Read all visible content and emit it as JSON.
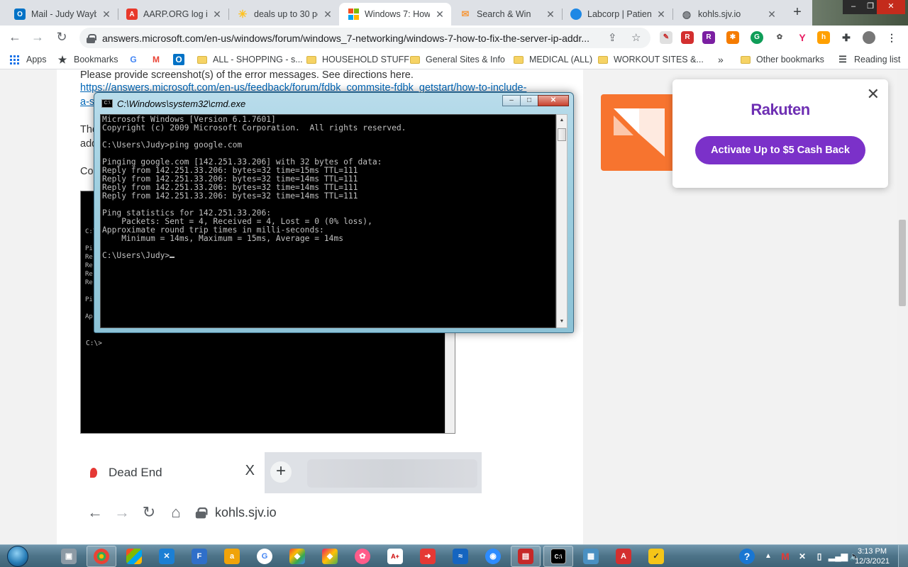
{
  "browser": {
    "tabs": [
      {
        "title": "Mail - Judy Wayb",
        "favicon": "outlook-icon",
        "color": "#0072c6"
      },
      {
        "title": "AARP.ORG log in",
        "favicon": "aarp-icon",
        "color": "#e8392b"
      },
      {
        "title": "deals up to 30 pe",
        "favicon": "walmart-icon",
        "color": "#ffc220"
      },
      {
        "title": "Windows 7: How",
        "favicon": "microsoft-icon",
        "color": "#f25022"
      },
      {
        "title": "Search & Win",
        "favicon": "mail-icon",
        "color": "#f59a3f"
      },
      {
        "title": "Labcorp | Patient",
        "favicon": "labcorp-icon",
        "color": "#1e88e5"
      },
      {
        "title": "kohls.sjv.io",
        "favicon": "globe-icon",
        "color": "#5f6368"
      }
    ],
    "active_tab": 3,
    "url": "answers.microsoft.com/en-us/windows/forum/windows_7-networking/windows-7-how-to-fix-the-server-ip-addr...",
    "bookmarks": [
      {
        "label": "Apps",
        "type": "apps"
      },
      {
        "label": "Bookmarks",
        "type": "star"
      },
      {
        "label": "",
        "type": "google"
      },
      {
        "label": "",
        "type": "gmail"
      },
      {
        "label": "",
        "type": "outlook"
      },
      {
        "label": "ALL - SHOPPING - s...",
        "type": "folder"
      },
      {
        "label": "HOUSEHOLD STUFF",
        "type": "folder"
      },
      {
        "label": "General Sites & Info",
        "type": "folder"
      },
      {
        "label": "MEDICAL (ALL)",
        "type": "folder"
      },
      {
        "label": "WORKOUT SITES &...",
        "type": "folder"
      },
      {
        "label": "Other bookmarks",
        "type": "folder"
      },
      {
        "label": "Reading list",
        "type": "reading"
      }
    ],
    "overflow": "»"
  },
  "article": {
    "line1": "Please provide screenshot(s) of the error messages. See directions here.",
    "link": "https://answers.microsoft.com/en-us/feedback/forum/fdbk_commsite-fdbk_getstart/how-to-include-",
    "link2": "a-s",
    "frag1": "The",
    "frag2": "add",
    "frag3": "Co",
    "bg_console_prompt": "C:\\>",
    "bg_console_left": [
      "C:\\",
      "Pi",
      "Re",
      "Re",
      "Re",
      "Re",
      "Pi",
      "Ap"
    ]
  },
  "embedded": {
    "tab_title": "Dead End",
    "close": "X",
    "plus": "+",
    "url": "kohls.sjv.io"
  },
  "cmd": {
    "title": "C:\\Windows\\system32\\cmd.exe",
    "lines": [
      "Microsoft Windows [Version 6.1.7601]",
      "Copyright (c) 2009 Microsoft Corporation.  All rights reserved.",
      "",
      "C:\\Users\\Judy>ping google.com",
      "",
      "Pinging google.com [142.251.33.206] with 32 bytes of data:",
      "Reply from 142.251.33.206: bytes=32 time=15ms TTL=111",
      "Reply from 142.251.33.206: bytes=32 time=14ms TTL=111",
      "Reply from 142.251.33.206: bytes=32 time=14ms TTL=111",
      "Reply from 142.251.33.206: bytes=32 time=14ms TTL=111",
      "",
      "Ping statistics for 142.251.33.206:",
      "    Packets: Sent = 4, Received = 4, Lost = 0 (0% loss),",
      "Approximate round trip times in milli-seconds:",
      "    Minimum = 14ms, Maximum = 15ms, Average = 14ms",
      "",
      "C:\\Users\\Judy>"
    ]
  },
  "rakuten": {
    "logo": "Rakuten",
    "button": "Activate Up to $5 Cash Back",
    "close": "✕"
  },
  "taskbar": {
    "time": "3:13 PM",
    "date": "12/3/2021"
  }
}
